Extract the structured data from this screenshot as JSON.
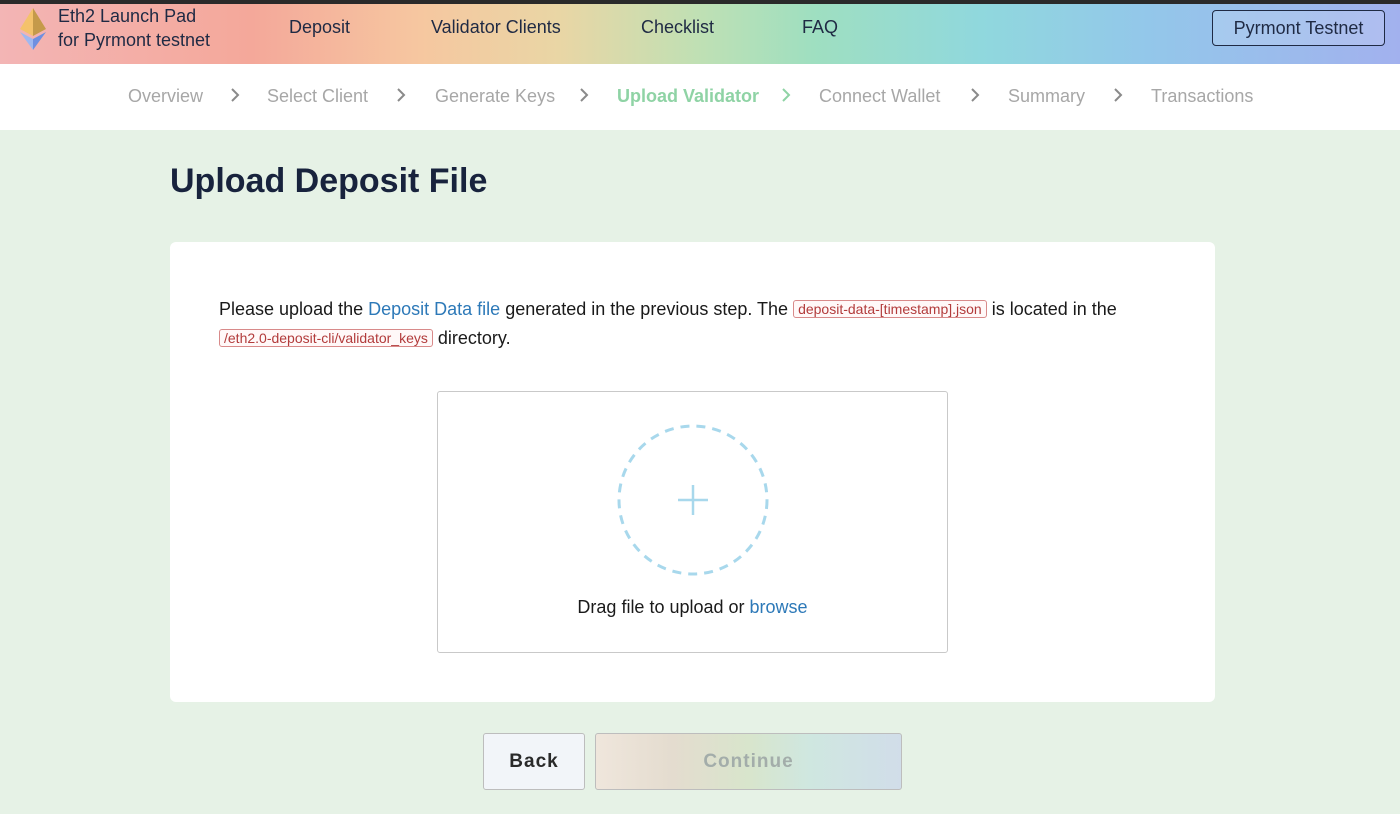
{
  "header": {
    "brand_line1": "Eth2 Launch Pad",
    "brand_line2": "for Pyrmont testnet",
    "nav": [
      "Deposit",
      "Validator Clients",
      "Checklist",
      "FAQ"
    ],
    "network_button": "Pyrmont Testnet"
  },
  "steps": [
    {
      "label": "Overview",
      "active": false
    },
    {
      "label": "Select Client",
      "active": false
    },
    {
      "label": "Generate Keys",
      "active": false
    },
    {
      "label": "Upload Validator",
      "active": true
    },
    {
      "label": "Connect Wallet",
      "active": false
    },
    {
      "label": "Summary",
      "active": false
    },
    {
      "label": "Transactions",
      "active": false
    }
  ],
  "main": {
    "title": "Upload Deposit File",
    "desc_part1": "Please upload the ",
    "desc_link": "Deposit Data file",
    "desc_part2": " generated in the previous step. The ",
    "desc_code1": "deposit-data-[timestamp].json",
    "desc_part3": " is located in the ",
    "desc_code2": "/eth2.0-deposit-cli/validator_keys",
    "desc_part4": " directory.",
    "drop_text": "Drag file to upload or ",
    "drop_link": "browse"
  },
  "buttons": {
    "back": "Back",
    "continue": "Continue"
  },
  "colors": {
    "active_step": "#8fd3a5",
    "link": "#2d79b8",
    "code": "#b23b3b",
    "drop_circle": "#a8d8ec",
    "page_bg": "#e6f2e6"
  },
  "icons": {
    "logo": "ethereum-diamond-icon",
    "step_separator": "chevron-right-icon",
    "drop": "plus-icon"
  }
}
